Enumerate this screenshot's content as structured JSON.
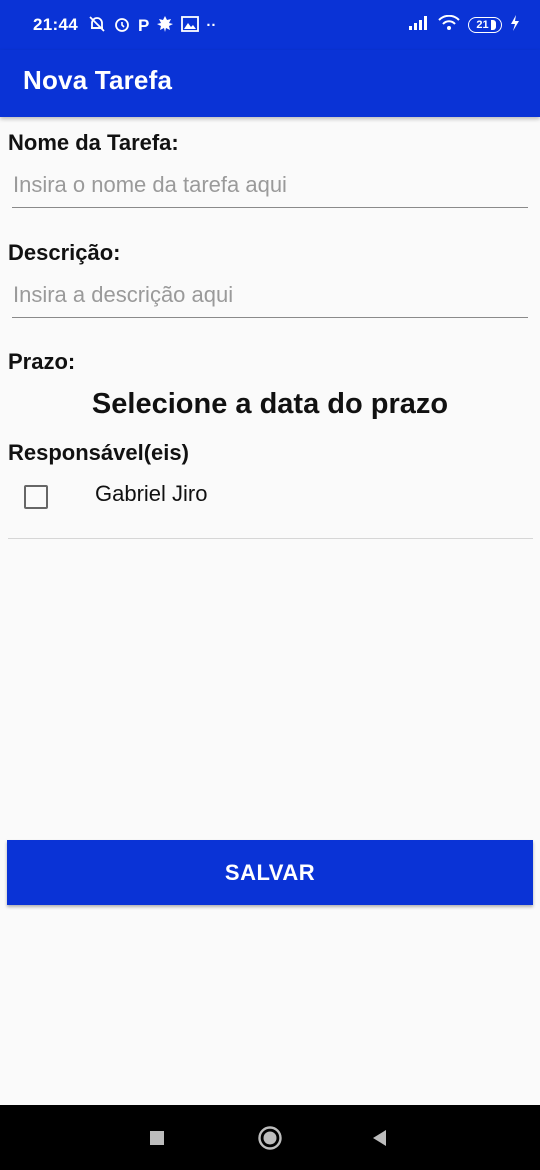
{
  "status_bar": {
    "time": "21:44",
    "battery_level": "21"
  },
  "app_bar": {
    "title": "Nova Tarefa"
  },
  "form": {
    "name_label": "Nome da Tarefa:",
    "name_placeholder": "Insira o nome da tarefa aqui",
    "name_value": "",
    "description_label": "Descrição:",
    "description_placeholder": "Insira a descrição aqui",
    "description_value": "",
    "deadline_label": "Prazo:",
    "deadline_picker_text": "Selecione a data do prazo",
    "responsible_label": "Responsável(eis)",
    "responsibles": [
      {
        "name": "Gabriel Jiro",
        "checked": false
      }
    ],
    "save_label": "SALVAR"
  },
  "colors": {
    "primary": "#0a33d6",
    "background": "#fafafa"
  },
  "icons": {
    "nav_back": "back-triangle-icon",
    "nav_home": "home-circle-icon",
    "nav_recents": "recents-square-icon"
  }
}
